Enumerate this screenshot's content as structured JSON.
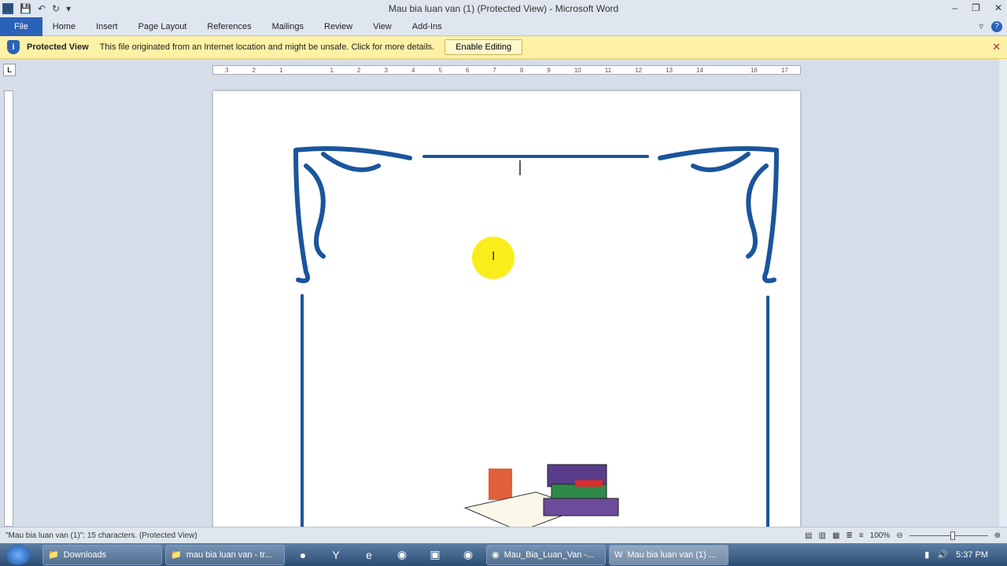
{
  "window": {
    "title": "Mau bia luan van (1) (Protected View) - Microsoft Word"
  },
  "ribbon": {
    "tabs": [
      "File",
      "Home",
      "Insert",
      "Page Layout",
      "References",
      "Mailings",
      "Review",
      "View",
      "Add-Ins"
    ]
  },
  "protected_view": {
    "label": "Protected View",
    "message": "This file originated from an Internet location and might be unsafe. Click for more details.",
    "button": "Enable Editing"
  },
  "ruler": {
    "ticks": [
      "3",
      "2",
      "1",
      "",
      "1",
      "2",
      "3",
      "4",
      "5",
      "6",
      "7",
      "8",
      "9",
      "10",
      "11",
      "12",
      "13",
      "14",
      "",
      "16",
      "17"
    ]
  },
  "status": {
    "text": "\"Mau bia luan van (1)\": 15 characters.  (Protected View)",
    "zoom": "100%"
  },
  "taskbar": {
    "items": [
      "Downloads",
      "mau bia luan van - tr...",
      "Mau_Bia_Luan_Van -...",
      "Mau bia luan van (1) ..."
    ],
    "clock": "5:37 PM"
  },
  "colors": {
    "border_blue": "#1a559c",
    "file_tab": "#2a62b8",
    "banner": "#fdf1a6"
  }
}
